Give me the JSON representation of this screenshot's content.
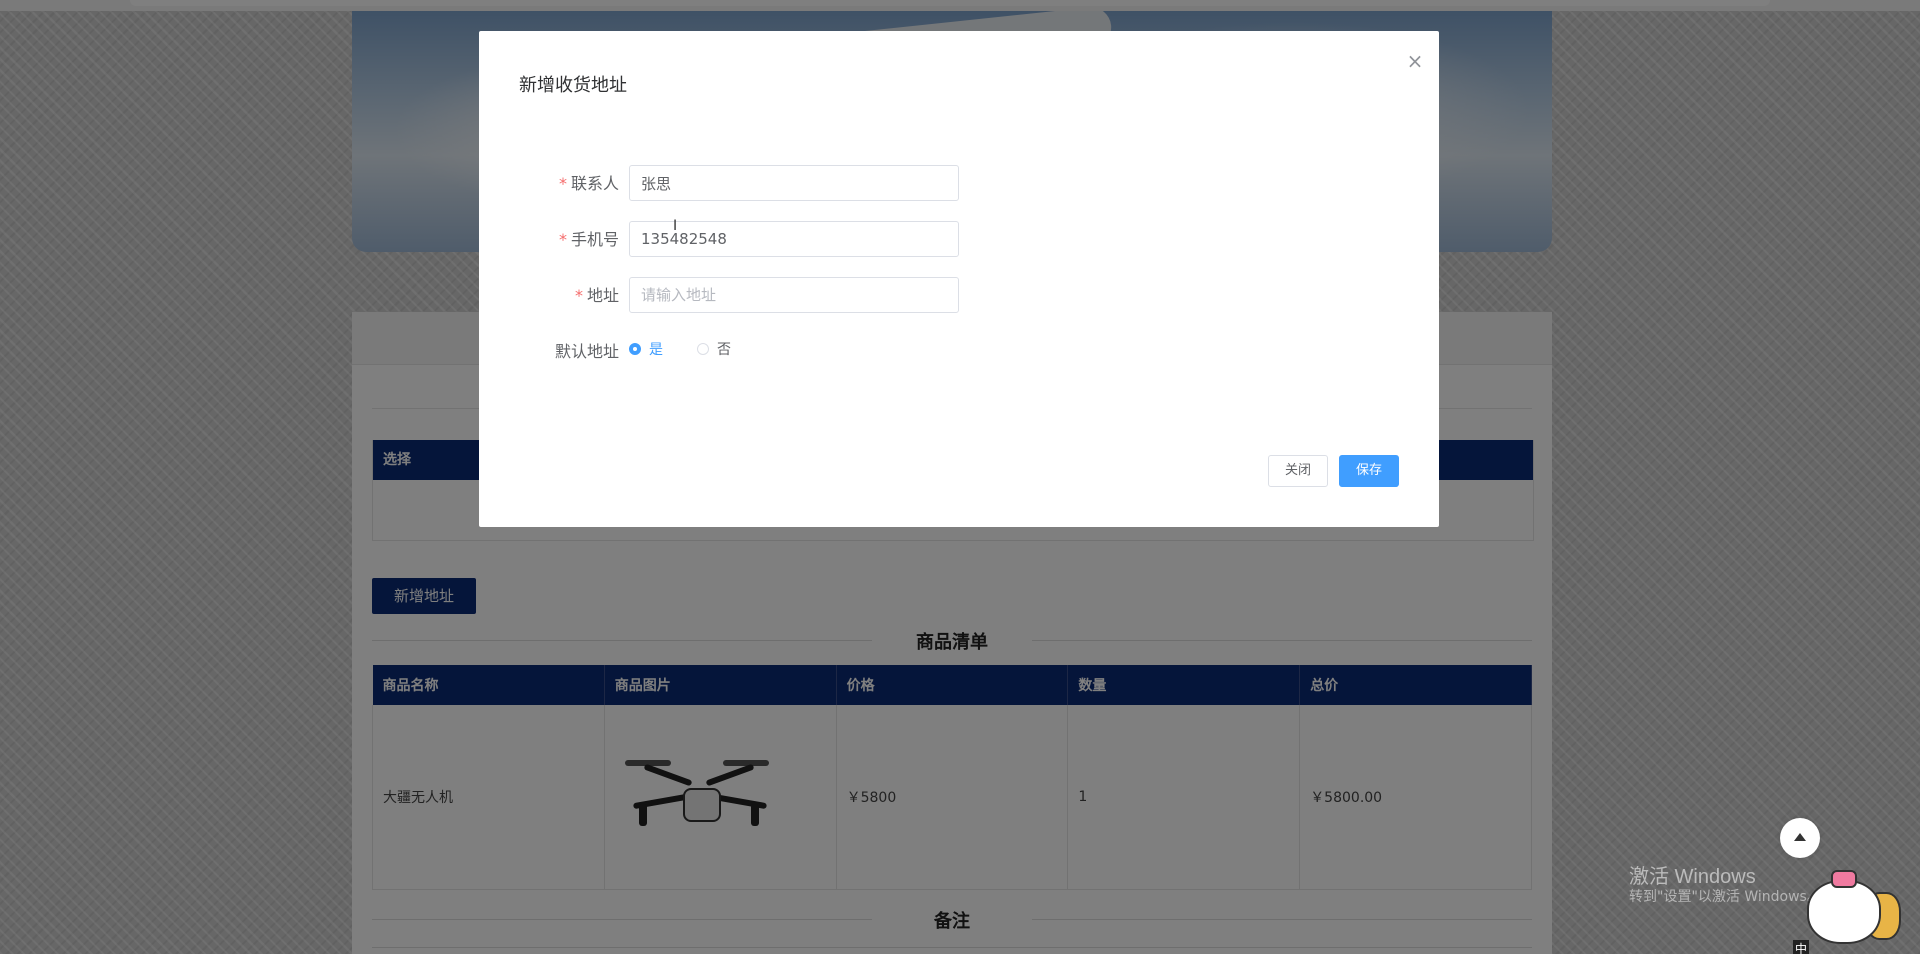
{
  "dialog": {
    "title": "新增收货地址",
    "close_icon": "close-icon",
    "fields": {
      "contact": {
        "label": "联系人",
        "required_mark": "*",
        "value": "张思"
      },
      "phone": {
        "label": "手机号",
        "required_mark": "*",
        "value": "135482548"
      },
      "address": {
        "label": "地址",
        "required_mark": "*",
        "value": "",
        "placeholder": "请输入地址"
      },
      "default_address": {
        "label": "默认地址",
        "options": [
          "是",
          "否"
        ],
        "selected": "是"
      }
    },
    "buttons": {
      "close": "关闭",
      "save": "保存"
    }
  },
  "page": {
    "address_table": {
      "header": "选择"
    },
    "add_address_button": "新增地址",
    "goods_section_title": "商品清单",
    "goods_table": {
      "headers": [
        "商品名称",
        "商品图片",
        "价格",
        "数量",
        "总价"
      ],
      "rows": [
        {
          "name": "大疆无人机",
          "image_icon": "drone-image",
          "price": "￥5800",
          "quantity": "1",
          "total": "￥5800.00"
        }
      ]
    },
    "note_section_title": "备注"
  },
  "overlay_widgets": {
    "back_to_top_icon": "arrow-up-icon",
    "watermark_line1": "激活 Windows",
    "watermark_line2": "转到\"设置\"以激活 Windows。",
    "ime_indicator": "中"
  },
  "colors": {
    "primary": "#409eff",
    "table_header": "#0b2a74",
    "required": "#f56c6c"
  }
}
